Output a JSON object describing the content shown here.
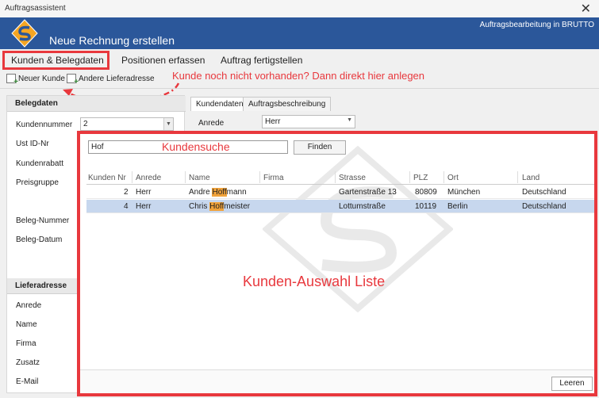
{
  "window": {
    "title": "Auftragsassistent"
  },
  "header": {
    "title": "Neue Rechnung erstellen",
    "app_label": "Auftragsbearbeitung in BRUTTO"
  },
  "tabs": [
    {
      "label": "Kunden & Belegdaten"
    },
    {
      "label": "Positionen erfassen"
    },
    {
      "label": "Auftrag fertigstellen"
    }
  ],
  "toolbar": {
    "new_customer": "Neuer Kunde",
    "other_address": "Andere Lieferadresse",
    "hint": "Kunde noch nicht vorhanden? Dann direkt hier anlegen"
  },
  "belegdaten": {
    "title": "Belegdaten",
    "fields": {
      "kundennummer": "Kundennummer",
      "kundennummer_value": "2",
      "ust": "Ust ID-Nr",
      "rabatt": "Kundenrabatt",
      "preisgruppe": "Preisgruppe",
      "belegnummer": "Beleg-Nummer",
      "belegdatum": "Beleg-Datum"
    }
  },
  "lieferadresse": {
    "title": "Lieferadresse",
    "fields": {
      "anrede": "Anrede",
      "name": "Name",
      "firma": "Firma",
      "zusatz": "Zusatz",
      "email": "E-Mail"
    }
  },
  "right_tabs": [
    {
      "label": "Kundendaten"
    },
    {
      "label": "Auftragsbeschreibung"
    }
  ],
  "kundendaten": {
    "anrede_label": "Anrede",
    "anrede_value": "Herr"
  },
  "search": {
    "value": "Hof",
    "annotation": "Kundensuche",
    "find_label": "Finden",
    "list_annotation": "Kunden-Auswahl Liste",
    "clear_label": "Leeren"
  },
  "grid": {
    "columns": [
      "Kunden Nr",
      "Anrede",
      "Name",
      "Firma",
      "Strasse",
      "PLZ",
      "Ort",
      "Land"
    ],
    "rows": [
      {
        "nr": "2",
        "anrede": "Herr",
        "name_pre": "Andre ",
        "name_hl": "Hoff",
        "name_post": "mann",
        "firma": "",
        "strasse": "Gartenstraße 13",
        "plz": "80809",
        "ort": "München",
        "land": "Deutschland",
        "selected": false
      },
      {
        "nr": "4",
        "anrede": "Herr",
        "name_pre": "Chris ",
        "name_hl": "Hoff",
        "name_post": "meister",
        "firma": "",
        "strasse": "Lottumstraße",
        "plz": "10119",
        "ort": "Berlin",
        "land": "Deutschland",
        "selected": true
      }
    ]
  },
  "colors": {
    "accent": "#e8383d",
    "header_blue": "#2b579a",
    "highlight": "#f0a23a",
    "selected_row": "#c7d7ee"
  }
}
